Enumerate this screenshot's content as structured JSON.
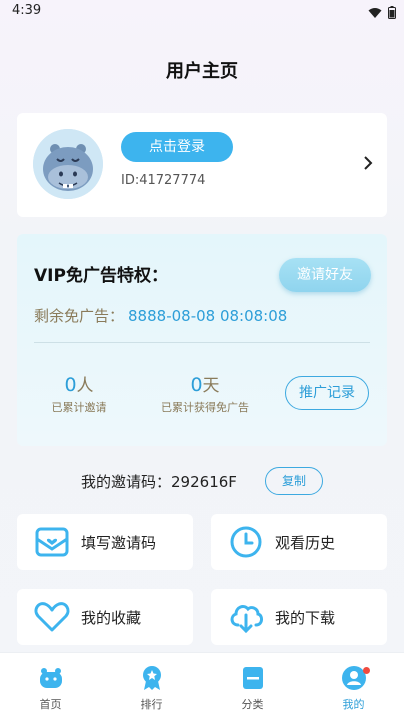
{
  "status": {
    "time": "4:39"
  },
  "header": {
    "title": "用户主页"
  },
  "profile": {
    "login_label": "点击登录",
    "user_id": "ID:41727774"
  },
  "vip": {
    "title": "VIP免广告特权：",
    "invite_label": "邀请好友",
    "ad_free_label": "剩余免广告：",
    "ad_free_until": "8888-08-08 08:08:08",
    "invited_count": "0",
    "invited_unit": "人",
    "invited_label": "已累计邀请",
    "days_count": "0",
    "days_unit": "天",
    "days_label": "已累计获得免广告",
    "record_label": "推广记录"
  },
  "invite_code": {
    "label": "我的邀请码：",
    "value": "292616F",
    "copy_label": "复制"
  },
  "menu": [
    {
      "label": "填写邀请码",
      "icon": "envelope-heart-icon"
    },
    {
      "label": "观看历史",
      "icon": "clock-icon"
    },
    {
      "label": "我的收藏",
      "icon": "heart-icon"
    },
    {
      "label": "我的下载",
      "icon": "cloud-download-icon"
    }
  ],
  "tabs": [
    {
      "label": "首页",
      "icon": "home-face-icon"
    },
    {
      "label": "排行",
      "icon": "ranking-badge-icon"
    },
    {
      "label": "分类",
      "icon": "category-icon"
    },
    {
      "label": "我的",
      "icon": "profile-icon",
      "active": true
    }
  ],
  "colors": {
    "accent": "#2d9ed8",
    "login": "#3db4ee",
    "gold_text": "#8a7b5a",
    "badge": "#f04a3e"
  }
}
